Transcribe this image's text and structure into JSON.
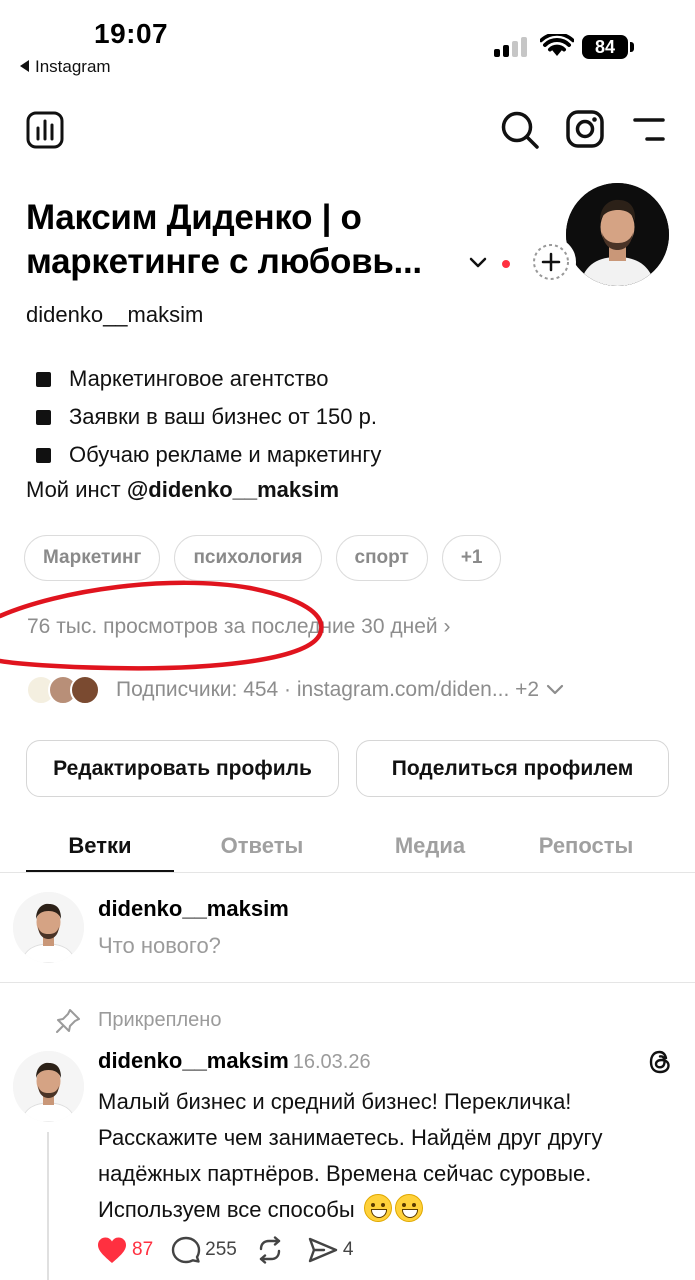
{
  "status_bar": {
    "time": "19:07",
    "back_app": "Instagram",
    "battery": "84"
  },
  "nav": {
    "left_icon": "insights-icon",
    "right_icons": [
      "search-icon",
      "instagram-icon",
      "menu-icon"
    ]
  },
  "profile": {
    "name": "Максим Диденко | о маркетинге с любовь...",
    "username": "didenko__maksim",
    "bio": [
      "Маркетинговое агентство",
      "Заявки в ваш бизнес от 150 р.",
      "Обучаю рекламе и маркетингу"
    ],
    "bio_link_prefix": "Мой инст ",
    "bio_link_handle": "@didenko__maksim",
    "chips": [
      "Маркетинг",
      "психология",
      "спорт",
      "+1"
    ],
    "views": "76 тыс. просмотров за последние 30 дней",
    "views_chevron": "›",
    "followers": "Подписчики: 454 · instagram.com/diden... +2"
  },
  "buttons": {
    "edit": "Редактировать профиль",
    "share": "Поделиться профилем"
  },
  "tabs": [
    "Ветки",
    "Ответы",
    "Медиа",
    "Репосты"
  ],
  "composer": {
    "username": "didenko__maksim",
    "placeholder": "Что нового?"
  },
  "post": {
    "pinned_label": "Прикреплено",
    "username": "didenko__maksim",
    "date": "16.03.26",
    "text": "Малый бизнес и средний бизнес! Перекличка! Расскажите чем занимаетесь. Найдём друг другу надёжных партнёров. Времена сейчас суровые. Используем все способы",
    "likes": "87",
    "comments": "255",
    "shares": "4"
  },
  "colors": {
    "accent_red": "#ff3040",
    "muted_text": "#8d8d8d",
    "annotation_red": "#e0141e"
  }
}
